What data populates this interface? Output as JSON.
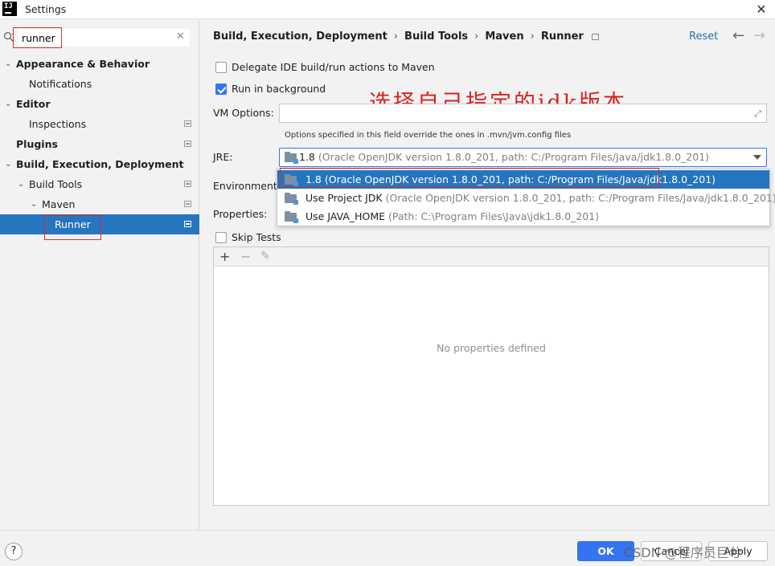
{
  "window": {
    "title": "Settings",
    "logo_text": "IJ"
  },
  "search": {
    "value": "runner"
  },
  "sidebar": {
    "items": [
      {
        "label": "Appearance & Behavior"
      },
      {
        "label": "Notifications"
      },
      {
        "label": "Editor"
      },
      {
        "label": "Inspections"
      },
      {
        "label": "Plugins"
      },
      {
        "label": "Build, Execution, Deployment"
      },
      {
        "label": "Build Tools"
      },
      {
        "label": "Maven"
      },
      {
        "label": "Runner"
      }
    ]
  },
  "header": {
    "breadcrumb": [
      "Build, Execution, Deployment",
      "Build Tools",
      "Maven",
      "Runner"
    ],
    "reset_label": "Reset"
  },
  "content": {
    "delegate_label": "Delegate IDE build/run actions to Maven",
    "run_background_label": "Run in background",
    "vm_options_label": "VM Options:",
    "vm_options_value": "",
    "vm_options_hint": "Options specified in this field override the ones in .mvn/jvm.config files",
    "jre_label": "JRE:",
    "jre_selected": {
      "main": "1.8",
      "detail": "(Oracle OpenJDK version 1.8.0_201, path: C:/Program Files/Java/jdk1.8.0_201)"
    },
    "jre_options": [
      {
        "main": "1.8",
        "detail": "(Oracle OpenJDK version 1.8.0_201, path: C:/Program Files/Java/jdk1.8.0_201)"
      },
      {
        "main": "Use Project JDK",
        "detail": "(Oracle OpenJDK version 1.8.0_201, path: C:/Program Files/Java/jdk1.8.0_201)"
      },
      {
        "main": "Use JAVA_HOME",
        "detail": "(Path: C:\\Program Files\\Java\\jdk1.8.0_201)"
      }
    ],
    "env_label": "Environment v",
    "properties_label": "Properties:",
    "skip_tests_label": "Skip Tests",
    "no_properties": "No properties defined",
    "annotation": "选择自己指定的jdk版本"
  },
  "footer": {
    "help": "?",
    "ok": "OK",
    "cancel": "Cancel",
    "apply": "Apply",
    "watermark": "CSDN @程序员巨兮"
  }
}
